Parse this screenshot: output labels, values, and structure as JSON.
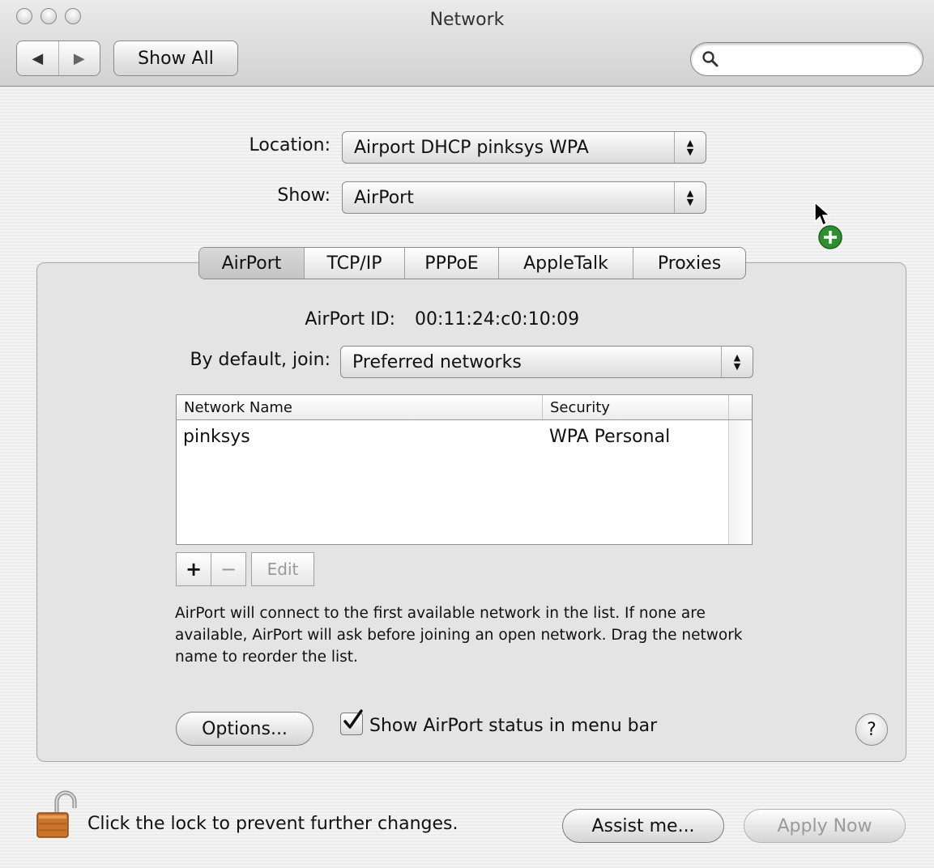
{
  "window": {
    "title": "Network"
  },
  "toolbar": {
    "back_icon": "back-arrow-icon",
    "forward_icon": "forward-arrow-icon",
    "show_all_label": "Show All",
    "search_placeholder": "",
    "search_icon": "magnifier-icon"
  },
  "location": {
    "label": "Location:",
    "value": "Airport DHCP pinksys WPA"
  },
  "show": {
    "label": "Show:",
    "value": "AirPort"
  },
  "tabs": [
    {
      "label": "AirPort",
      "selected": true
    },
    {
      "label": "TCP/IP",
      "selected": false
    },
    {
      "label": "PPPoE",
      "selected": false
    },
    {
      "label": "AppleTalk",
      "selected": false
    },
    {
      "label": "Proxies",
      "selected": false
    }
  ],
  "airport": {
    "id_label": "AirPort ID:",
    "id_value": "00:11:24:c0:10:09",
    "join_label": "By default, join:",
    "join_value": "Preferred networks",
    "table": {
      "columns": [
        "Network Name",
        "Security"
      ],
      "rows": [
        {
          "name": "pinksys",
          "security": "WPA Personal"
        }
      ]
    },
    "add_label": "+",
    "remove_label": "−",
    "edit_label": "Edit",
    "description": "AirPort will connect to the first available network in the list. If none are available, AirPort will ask before joining an open network. Drag the network name to reorder the list.",
    "options_label": "Options...",
    "show_status_label": "Show AirPort status in menu bar",
    "show_status_checked": true,
    "help_label": "?"
  },
  "footer": {
    "lock_text": "Click the lock to prevent further changes.",
    "assist_label": "Assist me...",
    "apply_label": "Apply Now"
  },
  "colors": {
    "add_badge": "#2f8f2f",
    "lock": "#c9742a"
  }
}
